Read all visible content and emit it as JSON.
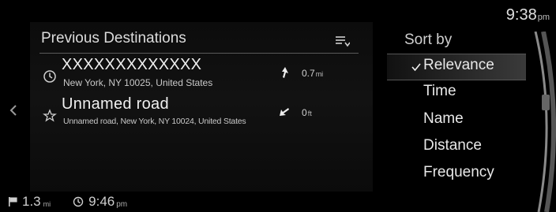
{
  "status_bar": {
    "time": "9:38",
    "ampm": "pm"
  },
  "list_panel": {
    "title": "Previous Destinations",
    "sort_icon": "sort-list-icon",
    "items": [
      {
        "icon": "recent-clock-icon",
        "name": "XXXXXXXXXXXXX",
        "address": "New York, NY 10025, United States",
        "direction": "arrow-up-icon",
        "distance": "0.7",
        "unit": "mi"
      },
      {
        "icon": "star-icon",
        "name": "Unnamed road",
        "address": "Unnamed road, New York, NY 10024, United States",
        "direction": "arrow-down-left-icon",
        "distance": "0",
        "unit": "ft"
      }
    ]
  },
  "sort_menu": {
    "header": "Sort by",
    "items": [
      "Relevance",
      "Time",
      "Name",
      "Distance",
      "Frequency"
    ],
    "selected_index": 0
  },
  "bottom": {
    "distance": "1.3",
    "distance_unit": "mi",
    "eta": "9:46",
    "eta_ampm": "pm"
  },
  "colors": {
    "background": "#000000",
    "text": "#e6e6e6",
    "divider": "#5a5a5a"
  }
}
